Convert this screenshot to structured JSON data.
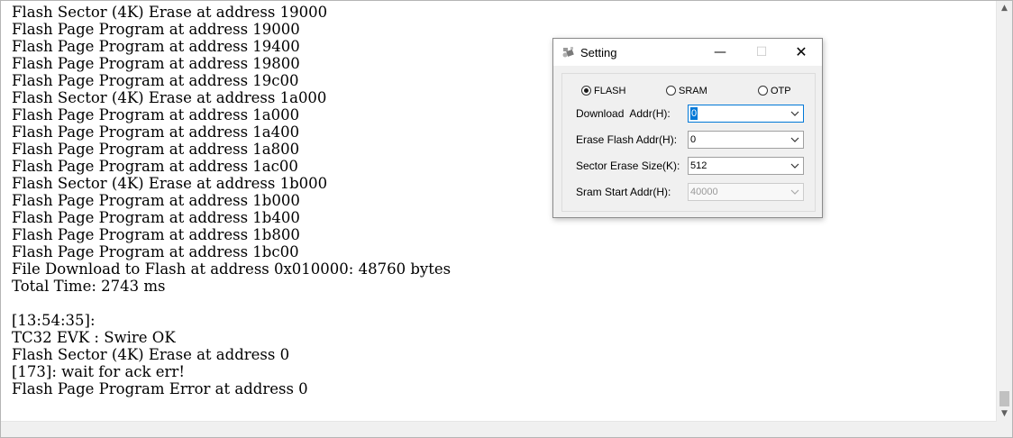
{
  "log": {
    "lines": [
      "Flash Sector (4K) Erase at address 19000",
      "Flash Page Program at address 19000",
      "Flash Page Program at address 19400",
      "Flash Page Program at address 19800",
      "Flash Page Program at address 19c00",
      "Flash Sector (4K) Erase at address 1a000",
      "Flash Page Program at address 1a000",
      "Flash Page Program at address 1a400",
      "Flash Page Program at address 1a800",
      "Flash Page Program at address 1ac00",
      "Flash Sector (4K) Erase at address 1b000",
      "Flash Page Program at address 1b000",
      "Flash Page Program at address 1b400",
      "Flash Page Program at address 1b800",
      "Flash Page Program at address 1bc00",
      "File Download to Flash at address 0x010000: 48760 bytes",
      "Total Time: 2743 ms",
      "",
      "[13:54:35]:",
      "TC32 EVK : Swire OK",
      "Flash Sector (4K) Erase at address 0",
      "[173]: wait for ack err!",
      "Flash Page Program Error at address 0"
    ]
  },
  "dialog": {
    "title": "Setting",
    "icon": "settings-app-icon",
    "buttons": {
      "minimize": "minimize-icon",
      "maximize": "maximize-icon",
      "close": "close-icon"
    },
    "mode_options": [
      {
        "label": "FLASH",
        "selected": true
      },
      {
        "label": "SRAM",
        "selected": false
      },
      {
        "label": "OTP",
        "selected": false
      }
    ],
    "fields": {
      "download_addr": {
        "label": "Download  Addr(H):",
        "value": "0",
        "enabled": true
      },
      "erase_flash_addr": {
        "label": "Erase Flash Addr(H):",
        "value": "0",
        "enabled": true
      },
      "sector_erase_size": {
        "label": "Sector Erase Size(K):",
        "value": "512",
        "enabled": true
      },
      "sram_start_addr": {
        "label": "Sram Start Addr(H):",
        "value": "40000",
        "enabled": false
      }
    }
  },
  "scrollbar": {
    "up_arrow": "scroll-up-icon",
    "down_arrow": "scroll-down-icon"
  },
  "colors": {
    "accent": "#0078d7",
    "dialog_bg": "#f0f0f0"
  }
}
